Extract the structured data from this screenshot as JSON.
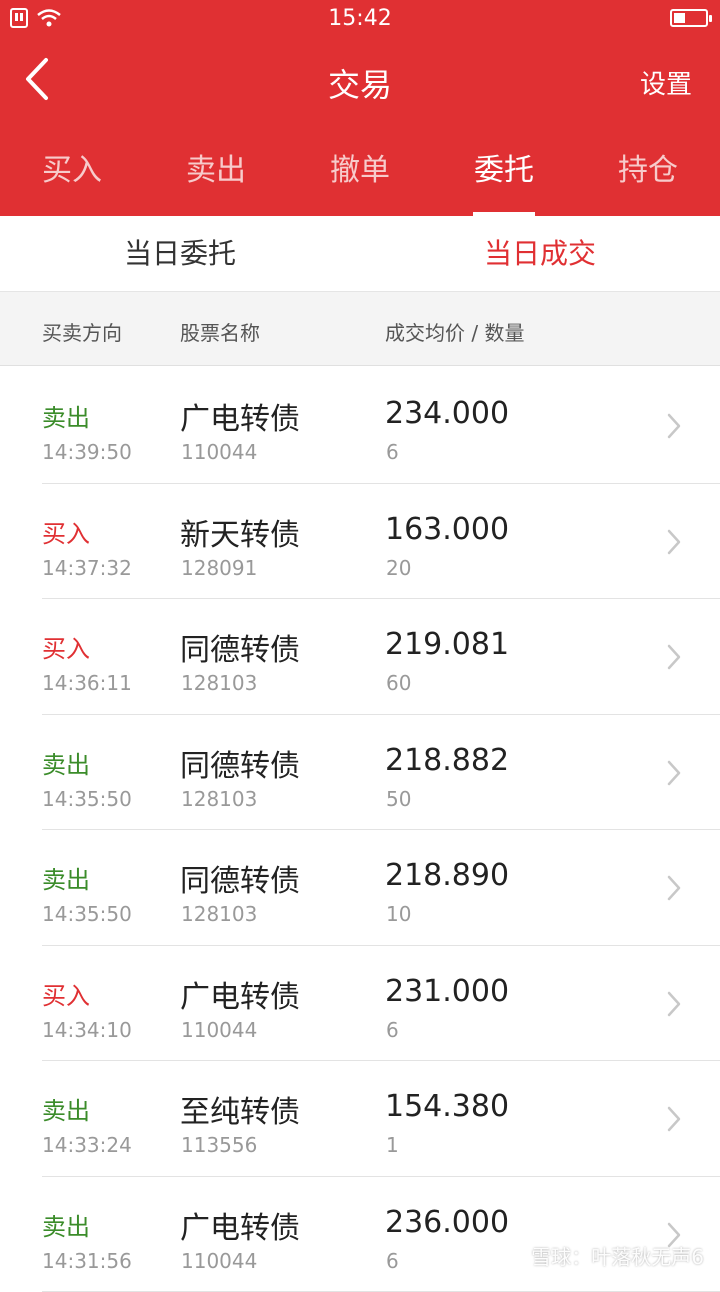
{
  "status_bar": {
    "time": "15:42",
    "battery_level": 0.35
  },
  "nav": {
    "title": "交易",
    "settings_label": "设置"
  },
  "tabs": [
    {
      "label": "买入",
      "active": false
    },
    {
      "label": "卖出",
      "active": false
    },
    {
      "label": "撤单",
      "active": false
    },
    {
      "label": "委托",
      "active": true
    },
    {
      "label": "持仓",
      "active": false
    }
  ],
  "subtabs": [
    {
      "label": "当日委托",
      "active": false
    },
    {
      "label": "当日成交",
      "active": true
    }
  ],
  "columns": {
    "direction": "买卖方向",
    "stock": "股票名称",
    "price_qty": "成交均价 / 数量"
  },
  "trades": [
    {
      "direction": "卖出",
      "time": "14:39:50",
      "name": "广电转债",
      "code": "110044",
      "price": "234.000",
      "qty": "6"
    },
    {
      "direction": "买入",
      "time": "14:37:32",
      "name": "新天转债",
      "code": "128091",
      "price": "163.000",
      "qty": "20"
    },
    {
      "direction": "买入",
      "time": "14:36:11",
      "name": "同德转债",
      "code": "128103",
      "price": "219.081",
      "qty": "60"
    },
    {
      "direction": "卖出",
      "time": "14:35:50",
      "name": "同德转债",
      "code": "128103",
      "price": "218.882",
      "qty": "50"
    },
    {
      "direction": "卖出",
      "time": "14:35:50",
      "name": "同德转债",
      "code": "128103",
      "price": "218.890",
      "qty": "10"
    },
    {
      "direction": "买入",
      "time": "14:34:10",
      "name": "广电转债",
      "code": "110044",
      "price": "231.000",
      "qty": "6"
    },
    {
      "direction": "卖出",
      "time": "14:33:24",
      "name": "至纯转债",
      "code": "113556",
      "price": "154.380",
      "qty": "1"
    },
    {
      "direction": "卖出",
      "time": "14:31:56",
      "name": "广电转债",
      "code": "110044",
      "price": "236.000",
      "qty": "6"
    }
  ],
  "watermark": "雪球：叶落秋无声6",
  "colors": {
    "brand_red": "#e03033",
    "sell_green": "#3b8c2a",
    "buy_red": "#e03033"
  }
}
